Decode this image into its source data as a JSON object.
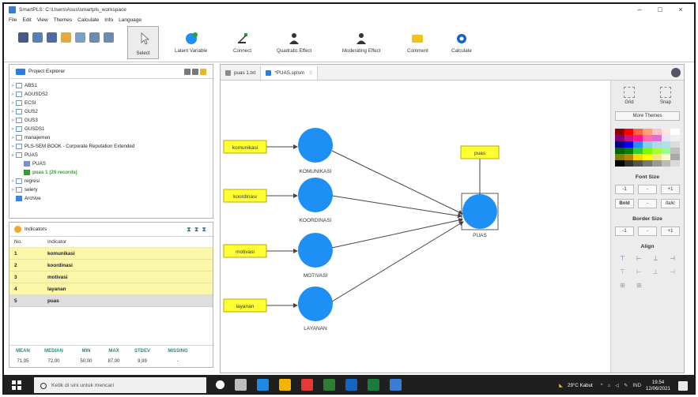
{
  "window": {
    "title": "SmartPLS: C:\\Users\\Asus\\smartpls_workspace",
    "controls": [
      "–",
      "□",
      "×"
    ]
  },
  "menu": [
    "File",
    "Edit",
    "View",
    "Themes",
    "Calculate",
    "Info",
    "Language"
  ],
  "toolbar": {
    "select_label": "Select",
    "latent_variable": "Latent Variable",
    "connect": "Connect",
    "quadratic_effect": "Quadratic Effect",
    "moderating_effect": "Moderating Effect",
    "comment": "Comment",
    "calculate": "Calculate"
  },
  "project_explorer": {
    "title": "Project Explorer",
    "items": [
      {
        "label": "ABS1",
        "kind": "project"
      },
      {
        "label": "AGUSDS2",
        "kind": "project"
      },
      {
        "label": "ECSI",
        "kind": "project"
      },
      {
        "label": "GUS2",
        "kind": "project"
      },
      {
        "label": "GUS3",
        "kind": "project"
      },
      {
        "label": "GUSDS1",
        "kind": "project"
      },
      {
        "label": "manajemen",
        "kind": "project"
      },
      {
        "label": "PLS-SEM BOOK - Corporate Reputation Extended",
        "kind": "project"
      },
      {
        "label": "PUAS",
        "kind": "project-open"
      },
      {
        "label": "PUAS",
        "kind": "model"
      },
      {
        "label": "puas 1 (20 records)",
        "kind": "data"
      },
      {
        "label": "regresi",
        "kind": "project"
      },
      {
        "label": "selery",
        "kind": "project"
      },
      {
        "label": "Archive",
        "kind": "archive"
      }
    ]
  },
  "indicators": {
    "title": "Indicators",
    "columns": [
      "No.",
      "Indicator"
    ],
    "rows": [
      {
        "no": "1",
        "name": "komunikasi"
      },
      {
        "no": "2",
        "name": "koordinasi"
      },
      {
        "no": "3",
        "name": "motivasi"
      },
      {
        "no": "4",
        "name": "layanan"
      },
      {
        "no": "5",
        "name": "puas"
      }
    ],
    "stats_headers": [
      "MEAN",
      "MEDIAN",
      "MIN",
      "MAX",
      "STDEV",
      "MISSING"
    ],
    "stats_values": [
      "71,05",
      "72,00",
      "50,00",
      "87,00",
      "9,99",
      "-"
    ]
  },
  "tabs": [
    {
      "label": "puas 1.txt",
      "active": false
    },
    {
      "label": "*PUAS.splsm",
      "active": true
    }
  ],
  "model": {
    "indicators": [
      "komunikasi",
      "koordinasi",
      "motivasi",
      "layanan",
      "puas"
    ],
    "constructs": [
      "KOMUNIKASI",
      "KOORDINASI",
      "MOTIVASI",
      "LAYANAN",
      "PUAS"
    ],
    "colors": {
      "construct": "#1e90f5",
      "indicator": "#ffff33",
      "indicator_border": "#b9a800",
      "path": "#444444"
    }
  },
  "palette": {
    "grid": "Grid",
    "snap": "Snap",
    "more_themes": "More Themes",
    "font_size": "Font Size",
    "border_size": "Border Size",
    "align": "Align",
    "minus": "-1",
    "dash": "-",
    "plus": "+1",
    "bold": "Bold",
    "italic": "Italic",
    "swatch_colors": [
      "#8b0000",
      "#ff0000",
      "#ff6347",
      "#ffa07a",
      "#ffc0cb",
      "#ffe4e1",
      "#ffffff",
      "#800080",
      "#c71585",
      "#ff1493",
      "#ff69b4",
      "#da70d6",
      "#e6e6fa",
      "#f0f0f0",
      "#00008b",
      "#0000ff",
      "#1e90ff",
      "#87ceeb",
      "#add8e6",
      "#b0e0e6",
      "#dcdcdc",
      "#006400",
      "#008000",
      "#32cd32",
      "#7cfc00",
      "#adff2f",
      "#98fb98",
      "#c0c0c0",
      "#808000",
      "#b8860b",
      "#ffd700",
      "#ffff00",
      "#f0e68c",
      "#fffacd",
      "#a9a9a9",
      "#000000",
      "#333333",
      "#555555",
      "#777777",
      "#999999",
      "#bbbbbb",
      "#d9d9d9"
    ]
  },
  "taskbar": {
    "search_placeholder": "Ketik di sini untuk mencari",
    "weather": "29°C Kabut",
    "lang": "IND",
    "time": "19.54",
    "date": "12/06/2021"
  }
}
